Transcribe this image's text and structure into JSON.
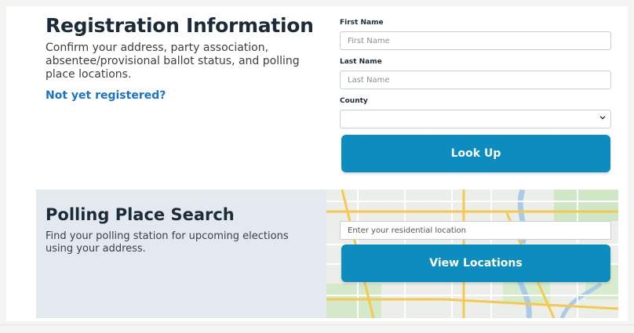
{
  "registration": {
    "title": "Registration Information",
    "description": "Confirm your address, party association, absentee/provisional ballot status, and polling place locations.",
    "link_label": "Not yet registered?"
  },
  "form": {
    "first_name": {
      "label": "First Name",
      "placeholder": "First Name",
      "value": ""
    },
    "last_name": {
      "label": "Last Name",
      "placeholder": "Last Name",
      "value": ""
    },
    "county": {
      "label": "County",
      "selected": ""
    },
    "lookup_label": "Look Up"
  },
  "polling": {
    "title": "Polling Place Search",
    "description": "Find your polling station for upcoming elections using your address.",
    "location_placeholder": "Enter your residential location",
    "view_label": "View Locations"
  },
  "colors": {
    "button": "#0c8cbf",
    "link": "#1a73c9",
    "heading": "#1c2b39",
    "poll_background": "#e4e9ef"
  },
  "icons": {
    "select_chevron": "chevron-down-icon"
  }
}
